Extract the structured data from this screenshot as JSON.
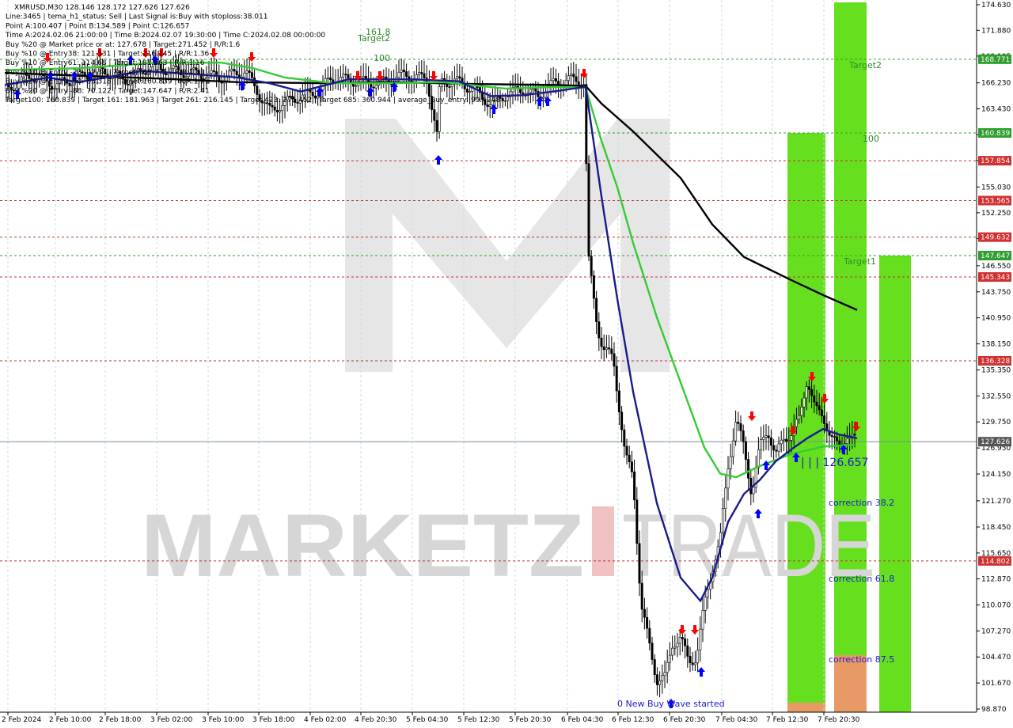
{
  "header": {
    "lines": [
      "XMRUSD,M30  128.146 128.172 127.626 127.626",
      "Line:3465  |  tema_h1_status: Sell  |  Last Signal is:Buy with stoploss:38.011",
      "Point A:100.407  |  Point B:134.589  |  Point C:126.657",
      "Time A:2024.02.06 21:00:00  |  Time B:2024.02.07 19:30:00  |  Time C:2024.02.08 00:00:00",
      "Buy %20 @ Market price or at: 127.678  |  Target:271.452  |  R/R:1.6",
      "Buy %10 @ Entry38: 121.531  |  Target:216.145  |  R/R:1.36",
      "Buy %10 @ Entry61: 114.68  |  Target:181.963  |  R/R:1.16",
      "Buy %10 @ Entry -23: 92.34  |  Target:168.771  |  R/R:1.41",
      "Buy %20 @ Entry -50: 83.316  |  Target:160.839  |  R/R:1.71",
      "Buy %20 @ Entry -88: 70.122  |  Target:147.647  |  R/R:2.41",
      "Target100: 160.839  |  Target 161: 181.963  |  Target 261: 216.145  |  Target 423: 271.452  |  Target 685: 360.944  |  average_Buy_entry: 99.4248"
    ]
  },
  "price_axis": {
    "ticks": [
      "174.630",
      "171.880",
      "169.105",
      "166.230",
      "163.430",
      "160.655",
      "157.880",
      "155.030",
      "152.250",
      "149.480",
      "146.550",
      "143.750",
      "140.950",
      "138.150",
      "135.350",
      "132.550",
      "129.750",
      "126.950",
      "124.150",
      "121.270",
      "118.450",
      "115.650",
      "112.870",
      "110.070",
      "107.270",
      "104.470",
      "101.670",
      "98.870"
    ],
    "min": 98.87,
    "max": 174.63
  },
  "time_axis": {
    "labels": [
      "2 Feb 2024",
      "2 Feb 10:00",
      "2 Feb 18:00",
      "3 Feb 02:00",
      "3 Feb 10:00",
      "3 Feb 18:00",
      "4 Feb 02:00",
      "4 Feb 20:30",
      "5 Feb 04:30",
      "5 Feb 12:30",
      "5 Feb 20:30",
      "6 Feb 04:30",
      "6 Feb 12:30",
      "6 Feb 20:30",
      "7 Feb 04:30",
      "7 Feb 12:30",
      "7 Feb 20:30"
    ]
  },
  "level_tags": [
    {
      "value": 168.771,
      "label": "168.771",
      "color": "#2e9e2e",
      "line": "green"
    },
    {
      "value": 160.839,
      "label": "160.839",
      "color": "#2e9e2e",
      "line": "green"
    },
    {
      "value": 157.854,
      "label": "157.854",
      "color": "#d03030",
      "line": "red"
    },
    {
      "value": 153.565,
      "label": "153.565",
      "color": "#d03030",
      "line": "red"
    },
    {
      "value": 149.632,
      "label": "149.632",
      "color": "#d03030",
      "line": "red"
    },
    {
      "value": 147.647,
      "label": "147.647",
      "color": "#2e9e2e",
      "line": "green"
    },
    {
      "value": 145.343,
      "label": "145.343",
      "color": "#d03030",
      "line": "red"
    },
    {
      "value": 136.328,
      "label": "136.328",
      "color": "#d03030",
      "line": "red"
    },
    {
      "value": 127.626,
      "label": "127.626",
      "color": "#555555",
      "line": "current"
    },
    {
      "value": 114.802,
      "label": "114.802",
      "color": "#d03030",
      "line": "red"
    }
  ],
  "annotations": {
    "target2_top": "Target2",
    "label_161_8": "161.8",
    "label_100_top": "100",
    "target2_right": "Target2",
    "label_100_right": "100",
    "target1": "Target1",
    "point_c_label": "| | | 126.657",
    "correction_38": "correction 38.2",
    "correction_61": "correction 61.8",
    "correction_87": "correction 87.5",
    "wave_started": "0 New Buy Wave started"
  },
  "watermark": {
    "text_left": "MARKETZ",
    "text_right": "TRADE"
  },
  "colors": {
    "bull_zone": "#66e01e",
    "peach_zone": "#e89a66",
    "ema_fast": "#1a1a8c",
    "ema_mid": "#33cc33",
    "ema_slow": "#000000",
    "buy_arrow": "#0000ff",
    "sell_arrow": "#ff0000"
  }
}
